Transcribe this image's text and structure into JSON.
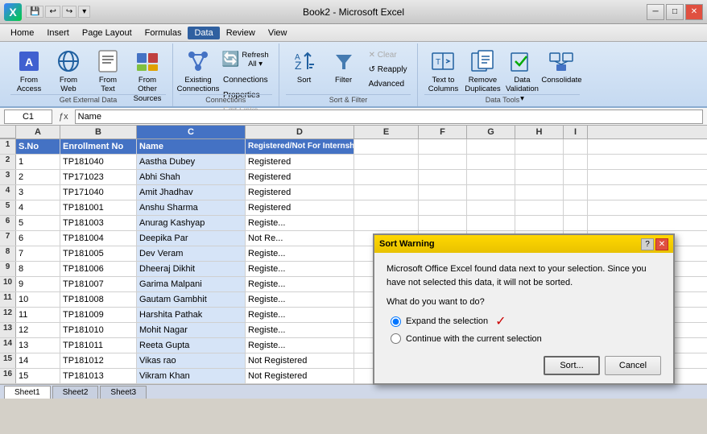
{
  "titlebar": {
    "title": "Book2 - Microsoft Excel",
    "buttons": [
      "─",
      "□",
      "✕"
    ]
  },
  "menubar": {
    "items": [
      "Home",
      "Insert",
      "Page Layout",
      "Formulas",
      "Data",
      "Review",
      "View"
    ],
    "active": "Data"
  },
  "ribbon": {
    "groups": [
      {
        "label": "Get External Data",
        "buttons": [
          {
            "id": "from-access",
            "label": "From\nAccess",
            "icon": "🗄"
          },
          {
            "id": "from-web",
            "label": "From\nWeb",
            "icon": "🌐"
          },
          {
            "id": "from-text",
            "label": "From\nText",
            "icon": "📄"
          },
          {
            "id": "from-other",
            "label": "From Other\nSources",
            "icon": "📊"
          }
        ]
      },
      {
        "label": "Connections",
        "buttons": [
          {
            "id": "existing-connections",
            "label": "Existing\nConnections",
            "icon": "🔗"
          },
          {
            "id": "refresh",
            "label": "Refresh\nAll",
            "icon": "🔄"
          }
        ],
        "smallButtons": [
          {
            "id": "connections",
            "label": "Connections"
          },
          {
            "id": "properties",
            "label": "Properties"
          },
          {
            "id": "edit-links",
            "label": "Edit Links"
          }
        ]
      },
      {
        "label": "Sort & Filter",
        "buttons": [
          {
            "id": "sort",
            "label": "Sort",
            "icon": "↕"
          },
          {
            "id": "filter",
            "label": "Filter",
            "icon": "▽"
          }
        ],
        "smallButtons": [
          {
            "id": "clear",
            "label": "Clear"
          },
          {
            "id": "reapply",
            "label": "Reapply"
          },
          {
            "id": "advanced",
            "label": "Advanced"
          }
        ]
      },
      {
        "label": "Data Tools",
        "buttons": [
          {
            "id": "text-to-columns",
            "label": "Text to\nColumns",
            "icon": "⬌"
          },
          {
            "id": "remove-duplicates",
            "label": "Remove\nDuplicates",
            "icon": "🗂"
          },
          {
            "id": "data-validation",
            "label": "Data\nValidation",
            "icon": "✓"
          },
          {
            "id": "consolidate",
            "label": "Consolidate",
            "icon": "⊕"
          }
        ]
      }
    ]
  },
  "formulabar": {
    "cellref": "C1",
    "formula": "Name"
  },
  "columns": {
    "letters": [
      "",
      "A",
      "B",
      "C",
      "D",
      "E",
      "F",
      "G",
      "H",
      "I"
    ],
    "selected": "C"
  },
  "headers": {
    "row1": [
      "S.No",
      "Enrollment No",
      "Name",
      "Registered/Not For Internship",
      "",
      "",
      "",
      "",
      ""
    ]
  },
  "rows": [
    {
      "num": 2,
      "cells": [
        "1",
        "TP181040",
        "Aastha Dubey",
        "Registered",
        "",
        "",
        "",
        "",
        ""
      ]
    },
    {
      "num": 3,
      "cells": [
        "2",
        "TP171023",
        "Abhi Shah",
        "Registered",
        "",
        "",
        "",
        "",
        ""
      ]
    },
    {
      "num": 4,
      "cells": [
        "3",
        "TP171040",
        "Amit Jhadhav",
        "Registered",
        "",
        "",
        "",
        "",
        ""
      ]
    },
    {
      "num": 5,
      "cells": [
        "4",
        "TP181001",
        "Anshu Sharma",
        "Registered",
        "",
        "",
        "",
        "",
        ""
      ]
    },
    {
      "num": 6,
      "cells": [
        "5",
        "TP181003",
        "Anurag Kashyap",
        "Registe...",
        "",
        "",
        "",
        "",
        ""
      ]
    },
    {
      "num": 7,
      "cells": [
        "6",
        "TP181004",
        "Deepika Par",
        "Not Re...",
        "",
        "",
        "",
        "",
        ""
      ]
    },
    {
      "num": 8,
      "cells": [
        "7",
        "TP181005",
        "Dev Veram",
        "Registe...",
        "",
        "",
        "",
        "",
        ""
      ]
    },
    {
      "num": 9,
      "cells": [
        "8",
        "TP181006",
        "Dheeraj Dikhit",
        "Registe...",
        "",
        "",
        "",
        "",
        ""
      ]
    },
    {
      "num": 10,
      "cells": [
        "9",
        "TP181007",
        "Garima Malpani",
        "Registe...",
        "",
        "",
        "",
        "",
        ""
      ]
    },
    {
      "num": 11,
      "cells": [
        "10",
        "TP181008",
        "Gautam Gambhit",
        "Registe...",
        "",
        "",
        "",
        "",
        ""
      ]
    },
    {
      "num": 12,
      "cells": [
        "11",
        "TP181009",
        "Harshita Pathak",
        "Registe...",
        "",
        "",
        "",
        "",
        ""
      ]
    },
    {
      "num": 13,
      "cells": [
        "12",
        "TP181010",
        "Mohit Nagar",
        "Registe...",
        "",
        "",
        "",
        "",
        ""
      ]
    },
    {
      "num": 14,
      "cells": [
        "13",
        "TP181011",
        "Reeta Gupta",
        "Registe...",
        "",
        "",
        "",
        "",
        ""
      ]
    },
    {
      "num": 15,
      "cells": [
        "14",
        "TP181012",
        "Vikas rao",
        "Not Registered",
        "",
        "",
        "",
        "",
        ""
      ]
    },
    {
      "num": 16,
      "cells": [
        "15",
        "TP181013",
        "Vikram Khan",
        "Not Registered",
        "",
        "",
        "",
        "",
        ""
      ]
    }
  ],
  "dialog": {
    "title": "Sort Warning",
    "message": "Microsoft Office Excel found data next to your selection.  Since you have not selected this data, it will not be sorted.",
    "question": "What do you want to do?",
    "options": [
      {
        "id": "expand",
        "label": "Expand the selection",
        "checked": true
      },
      {
        "id": "current",
        "label": "Continue with the current selection",
        "checked": false
      }
    ],
    "buttons": {
      "sort": "Sort...",
      "cancel": "Cancel"
    }
  },
  "tabs": [
    "Sheet1",
    "Sheet2",
    "Sheet3"
  ],
  "activeTab": "Sheet1"
}
